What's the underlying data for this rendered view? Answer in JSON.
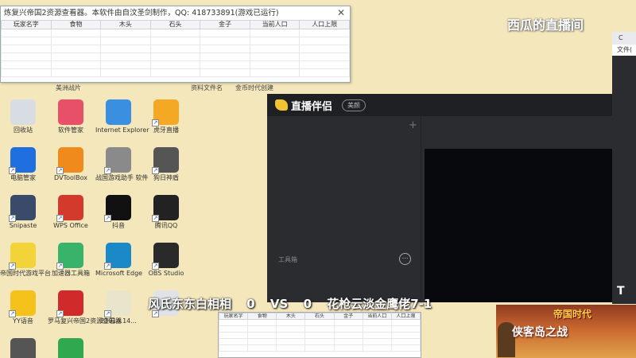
{
  "top_window": {
    "title": "炼复兴帝国2资源查看器。本软件由自汶圣剑制作，QQ: 418733891(游戏已运行)",
    "columns": [
      "玩家名字",
      "食物",
      "木头",
      "石头",
      "金子",
      "当前人口",
      "人口上限"
    ]
  },
  "watermark": "西瓜的直播间",
  "live_app": {
    "name": "直播伴侣",
    "pill": "美颜",
    "toolbox_label": "工具箱",
    "add": "+",
    "more": "⋯"
  },
  "right_strip": {
    "title": "C",
    "menu": "文件(",
    "tool": "T"
  },
  "overlay_score": {
    "left": "风氏东东白相相",
    "a": "0",
    "vs": "VS",
    "b": "0",
    "right": "花枪云淡金鹰佬7-1"
  },
  "mini_window": {
    "columns": [
      "玩家名字",
      "食物",
      "木头",
      "石头",
      "金子",
      "当前人口",
      "人口上限"
    ]
  },
  "ad": {
    "title": "帝国时代",
    "subtitle": "侠客岛之战"
  },
  "desktop": {
    "partial_labels": [
      "美洲战片",
      "资料文件名",
      "金币时代创建"
    ],
    "icons": [
      {
        "label": "回收站",
        "color": "#d8dde3"
      },
      {
        "label": "软件管家",
        "color": "#e8506a"
      },
      {
        "label": "Internet Explorer",
        "color": "#3b8fe0"
      },
      {
        "label": "虎牙直播",
        "color": "#f4a824"
      },
      {
        "label": "电脑管家",
        "color": "#1f6fe0"
      },
      {
        "label": "DVToolBox",
        "color": "#f08a1c"
      },
      {
        "label": "战国游戏助手 软件",
        "color": "#8a8a8a"
      },
      {
        "label": "狗日神盾",
        "color": "#555555"
      },
      {
        "label": "Snipaste",
        "color": "#3a4a6a"
      },
      {
        "label": "WPS Office",
        "color": "#d33a2c"
      },
      {
        "label": "抖音",
        "color": "#111111"
      },
      {
        "label": "腾讯QQ",
        "color": "#222222"
      },
      {
        "label": "帝国时代游戏平台",
        "color": "#f2d438"
      },
      {
        "label": "加速器工具箱",
        "color": "#3ab36a"
      },
      {
        "label": "Microsoft Edge",
        "color": "#1b88c8"
      },
      {
        "label": "OBS Studio",
        "color": "#2a2a2a"
      },
      {
        "label": "YY语音",
        "color": "#f5c21b"
      },
      {
        "label": "罗马复兴帝国2资源查看器",
        "color": "#d02a2a"
      },
      {
        "label": "23014.14...",
        "color": "#e9e4cc"
      },
      {
        "label": "",
        "color": "#dfe3e8"
      },
      {
        "label": "",
        "color": "#555555"
      },
      {
        "label": "",
        "color": "#2fa84f"
      }
    ]
  }
}
